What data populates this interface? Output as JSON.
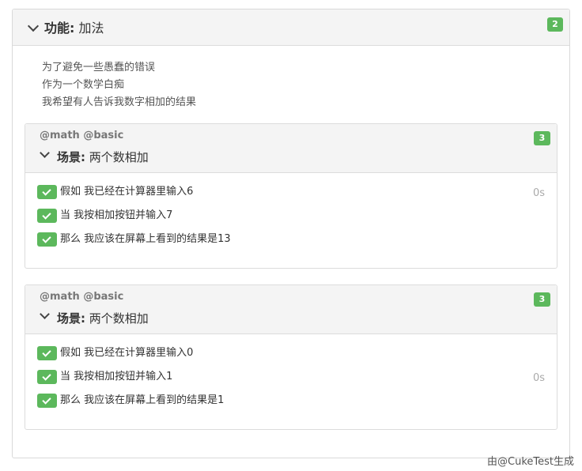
{
  "feature": {
    "keyword": "功能:",
    "name": "加法",
    "count": "2",
    "description": [
      "为了避免一些愚蠢的错误",
      "作为一个数学白痴",
      "我希望有人告诉我数字相加的结果"
    ]
  },
  "scenarios": [
    {
      "tags": "@math @basic",
      "keyword": "场景:",
      "name": "两个数相加",
      "count": "3",
      "duration": "0s",
      "steps": [
        {
          "keyword": "假如",
          "text": "我已经在计算器里输入6",
          "status": "passed"
        },
        {
          "keyword": "当",
          "text": "我按相加按钮并输入7",
          "status": "passed"
        },
        {
          "keyword": "那么",
          "text": "我应该在屏幕上看到的结果是13",
          "status": "passed"
        }
      ]
    },
    {
      "tags": "@math @basic",
      "keyword": "场景:",
      "name": "两个数相加",
      "count": "3",
      "duration": "0s",
      "steps": [
        {
          "keyword": "假如",
          "text": "我已经在计算器里输入0",
          "status": "passed"
        },
        {
          "keyword": "当",
          "text": "我按相加按钮并输入1",
          "status": "passed"
        },
        {
          "keyword": "那么",
          "text": "我应该在屏幕上看到的结果是1",
          "status": "passed"
        }
      ]
    }
  ],
  "footer": "由@CukeTest生成",
  "colors": {
    "success": "#5cb85c",
    "header_bg": "#f4f4f4",
    "border": "#dcdcdc"
  },
  "icons": {
    "collapse": "chevron-down-icon",
    "passed": "check-icon"
  }
}
